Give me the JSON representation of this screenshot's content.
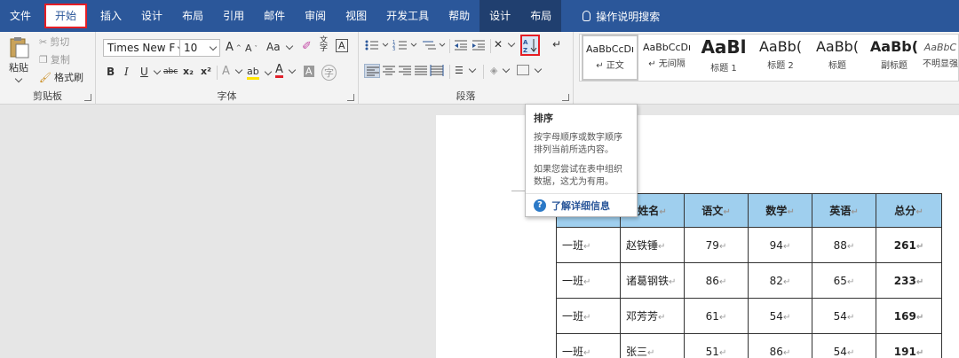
{
  "tabs": [
    "文件",
    "开始",
    "插入",
    "设计",
    "布局",
    "引用",
    "邮件",
    "审阅",
    "视图",
    "开发工具",
    "帮助"
  ],
  "context_tabs": [
    "设计",
    "布局"
  ],
  "tell_me": "操作说明搜索",
  "clipboard": {
    "label": "剪贴板",
    "paste": "粘贴",
    "cut": "剪切",
    "copy": "复制",
    "format_painter": "格式刷"
  },
  "font": {
    "label": "字体",
    "name": "Times New F",
    "size": "10",
    "grow": "A",
    "shrink": "A",
    "case": "Aa",
    "bold": "B",
    "italic": "I",
    "underline": "U",
    "strike": "abc",
    "sub": "x₂",
    "sup": "x²",
    "effects": "A",
    "highlight": "ab",
    "color": "A",
    "shade": "A",
    "enclose": "字",
    "phonetic": "文",
    "border": "A"
  },
  "paragraph": {
    "label": "段落",
    "sort": "A Z",
    "show_marks": "↵"
  },
  "styles": [
    {
      "preview": "AaBbCcDı",
      "name": "↵ 正文"
    },
    {
      "preview": "AaBbCcDı",
      "name": "↵ 无间隔"
    },
    {
      "preview": "AaBl",
      "name": "标题 1"
    },
    {
      "preview": "AaBb(",
      "name": "标题 2"
    },
    {
      "preview": "AaBb(",
      "name": "标题"
    },
    {
      "preview": "AaBb(",
      "name": "副标题"
    },
    {
      "preview": "AaBbC",
      "name": "不明显强"
    }
  ],
  "tooltip": {
    "title": "排序",
    "text1": "按字母顺序或数字顺序排列当前所选内容。",
    "text2": "如果您尝试在表中组织数据，这尤为有用。",
    "link": "了解详细信息"
  },
  "table": {
    "headers": [
      "",
      "姓名",
      "语文",
      "数学",
      "英语",
      "总分"
    ],
    "rows": [
      [
        "一班",
        "赵铁锤",
        "79",
        "94",
        "88",
        "261"
      ],
      [
        "一班",
        "诸葛钢铁",
        "86",
        "82",
        "65",
        "233"
      ],
      [
        "一班",
        "邓芳芳",
        "61",
        "54",
        "54",
        "169"
      ],
      [
        "一班",
        "张三",
        "51",
        "86",
        "54",
        "191"
      ]
    ],
    "mark": "↵"
  },
  "colors": {
    "ribbon": "#2b579a",
    "header_fill": "#9fcfee",
    "highlight_border": "#e51e25"
  }
}
